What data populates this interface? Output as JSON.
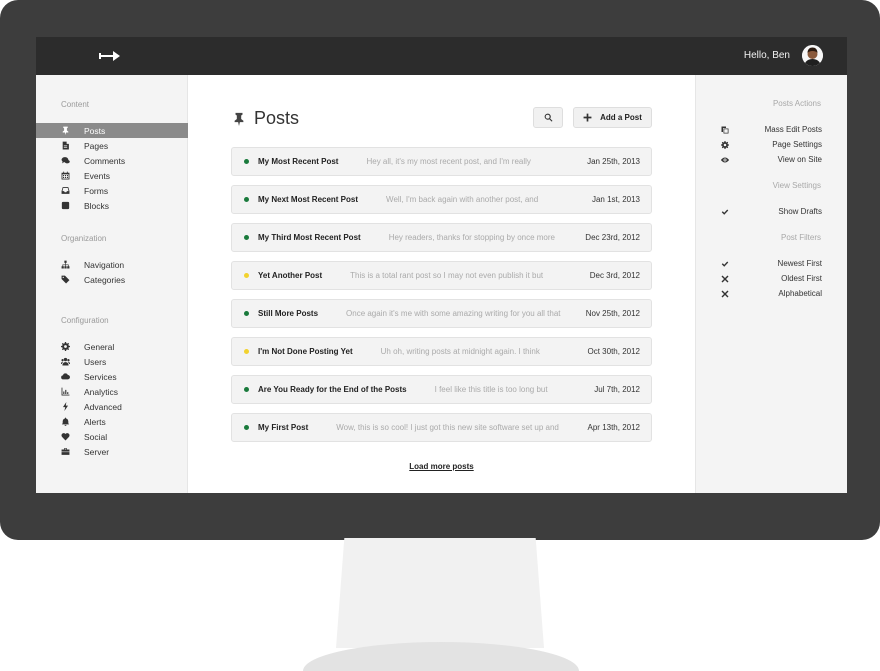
{
  "header": {
    "greeting": "Hello, Ben"
  },
  "sidebar": {
    "sections": [
      {
        "heading": "Content",
        "items": [
          {
            "label": "Posts",
            "icon": "pin-icon",
            "active": true
          },
          {
            "label": "Pages",
            "icon": "file-icon"
          },
          {
            "label": "Comments",
            "icon": "comments-icon"
          },
          {
            "label": "Events",
            "icon": "calendar-icon"
          },
          {
            "label": "Forms",
            "icon": "inbox-icon"
          },
          {
            "label": "Blocks",
            "icon": "stop-icon"
          }
        ]
      },
      {
        "heading": "Organization",
        "items": [
          {
            "label": "Navigation",
            "icon": "sitemap-icon"
          },
          {
            "label": "Categories",
            "icon": "tags-icon"
          }
        ]
      },
      {
        "heading": "Configuration",
        "items": [
          {
            "label": "General",
            "icon": "cog-icon"
          },
          {
            "label": "Users",
            "icon": "users-icon"
          },
          {
            "label": "Services",
            "icon": "cloud-icon"
          },
          {
            "label": "Analytics",
            "icon": "bar-chart-icon"
          },
          {
            "label": "Advanced",
            "icon": "bolt-icon"
          },
          {
            "label": "Alerts",
            "icon": "bell-icon"
          },
          {
            "label": "Social",
            "icon": "heart-icon"
          },
          {
            "label": "Server",
            "icon": "briefcase-icon"
          }
        ]
      }
    ]
  },
  "main": {
    "title": "Posts",
    "add_button": "Add a Post",
    "load_more": "Load more posts",
    "colors": {
      "published": "#1a7a3c",
      "draft": "#f2d22e"
    },
    "posts": [
      {
        "title": "My  Most Recent Post",
        "excerpt": "Hey all, it's my most recent post, and I'm really",
        "date": "Jan 25th, 2013",
        "status": "published"
      },
      {
        "title": "My  Next Most Recent Post",
        "excerpt": "Well, I'm back again with another post, and",
        "date": "Jan 1st, 2013",
        "status": "published"
      },
      {
        "title": "My  Third Most Recent Post",
        "excerpt": "Hey readers, thanks for stopping by once more",
        "date": "Dec 23rd, 2012",
        "status": "published"
      },
      {
        "title": "Yet Another Post",
        "excerpt": "This is a total rant post so I may not even publish it but",
        "date": "Dec 3rd, 2012",
        "status": "draft"
      },
      {
        "title": "Still More Posts",
        "excerpt": "Once again it's me with some amazing writing for you all that",
        "date": "Nov 25th, 2012",
        "status": "published"
      },
      {
        "title": "I'm Not Done Posting Yet",
        "excerpt": "Uh oh, writing posts at midnight again.  I think",
        "date": "Oct 30th, 2012",
        "status": "draft"
      },
      {
        "title": "Are You Ready for the End of the Posts",
        "excerpt": "I feel like this title is too long but",
        "date": "Jul 7th, 2012",
        "status": "published"
      },
      {
        "title": "My First Post",
        "excerpt": "Wow, this is so cool!  I just got this new site software set up and",
        "date": "Apr 13th, 2012",
        "status": "published"
      }
    ]
  },
  "rightbar": {
    "sections": [
      {
        "heading": "Posts Actions",
        "items": [
          {
            "label": "Mass Edit Posts",
            "icon": "copy-icon"
          },
          {
            "label": "Page Settings",
            "icon": "cog-icon"
          },
          {
            "label": "View on Site",
            "icon": "eye-icon"
          }
        ]
      },
      {
        "heading": "View Settings",
        "items": [
          {
            "label": "Show Drafts",
            "icon": "check-icon"
          }
        ]
      },
      {
        "heading": "Post Filters",
        "items": [
          {
            "label": "Newest First",
            "icon": "check-icon"
          },
          {
            "label": "Oldest First",
            "icon": "x-icon"
          },
          {
            "label": "Alphabetical",
            "icon": "x-icon"
          }
        ]
      }
    ]
  }
}
